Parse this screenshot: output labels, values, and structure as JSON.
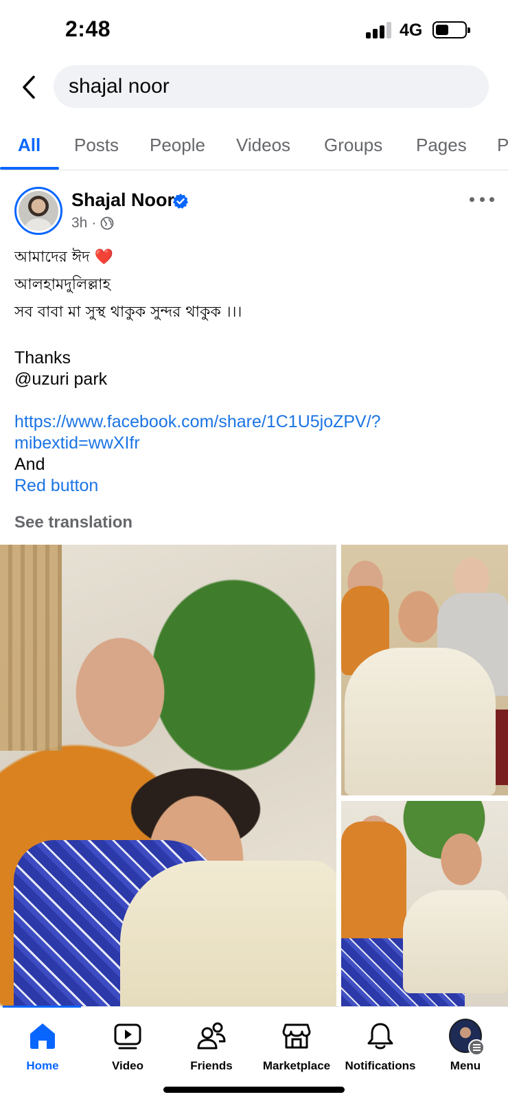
{
  "status_bar": {
    "time": "2:48",
    "network": "4G",
    "battery_level_percent": 35
  },
  "search": {
    "query": "shajal noor",
    "back_icon": "chevron-left-icon"
  },
  "tabs": [
    {
      "label": "All",
      "active": true
    },
    {
      "label": "Posts",
      "active": false
    },
    {
      "label": "People",
      "active": false
    },
    {
      "label": "Videos",
      "active": false
    },
    {
      "label": "Groups",
      "active": false
    },
    {
      "label": "Pages",
      "active": false
    },
    {
      "label": "P",
      "active": false
    }
  ],
  "post": {
    "author": "Shajal Noor",
    "verified": true,
    "time": "3h",
    "audience_icon": "globe-icon",
    "lines": [
      "আমাদের ঈদ ❤️",
      "আলহামদুলিল্লাহ",
      "সব বাবা মা সুস্থ থাকুক সুন্দর থাকুক ।।।",
      "",
      "Thanks",
      "@uzuri park",
      "",
      "https://www.facebook.com/share/1C1U5joZPV/?",
      "mibextid=wwXIfr",
      "And",
      "Red button"
    ],
    "see_translation": "See translation"
  },
  "bottom_nav": [
    {
      "label": "Home",
      "icon": "home-icon",
      "active": true
    },
    {
      "label": "Video",
      "icon": "video-icon",
      "active": false
    },
    {
      "label": "Friends",
      "icon": "friends-icon",
      "active": false
    },
    {
      "label": "Marketplace",
      "icon": "marketplace-icon",
      "active": false
    },
    {
      "label": "Notifications",
      "icon": "bell-icon",
      "active": false
    },
    {
      "label": "Menu",
      "icon": "menu-avatar",
      "active": false
    }
  ],
  "colors": {
    "accent": "#0866ff",
    "link": "#1b74e4",
    "secondary_text": "#65676b",
    "search_bg": "#f0f2f5"
  }
}
